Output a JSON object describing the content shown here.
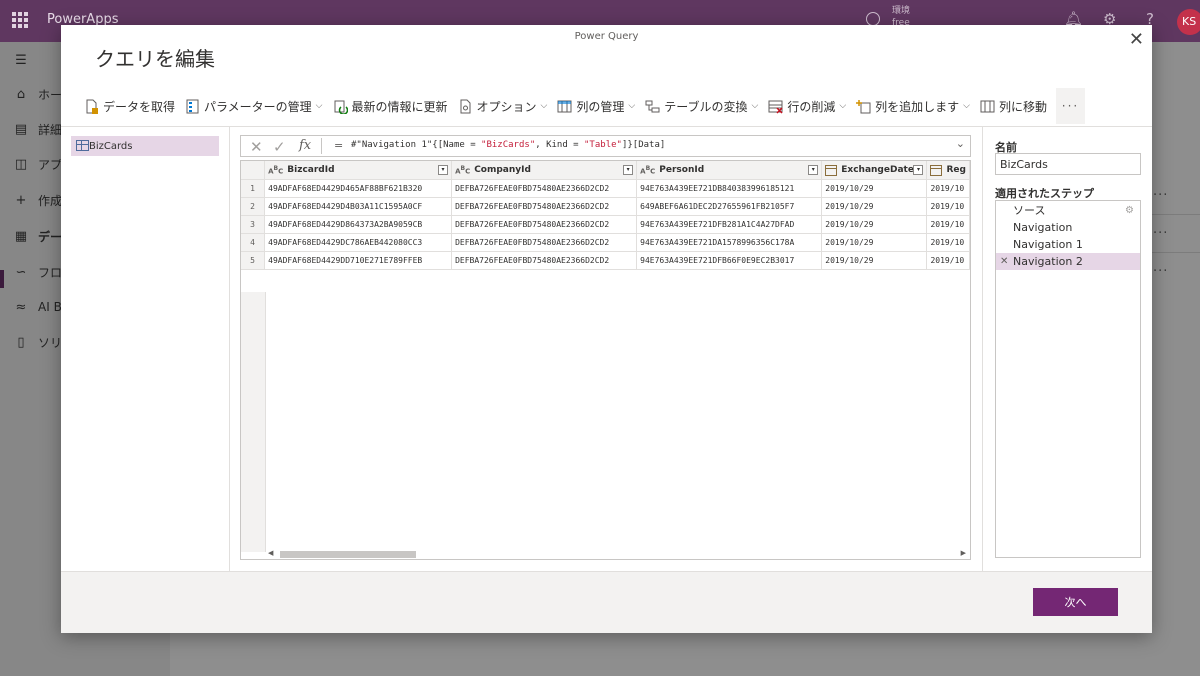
{
  "app": {
    "name": "PowerApps",
    "environment_label": "環境",
    "environment_value": "free",
    "avatar_initials": "KS"
  },
  "nav": {
    "items": [
      {
        "label": "ホー",
        "icon": "home-icon"
      },
      {
        "label": "詳細",
        "icon": "book-icon"
      },
      {
        "label": "アプ",
        "icon": "apps-icon"
      },
      {
        "label": "作成",
        "icon": "plus-icon"
      },
      {
        "label": "デー",
        "icon": "table-icon"
      },
      {
        "label": "フロ",
        "icon": "flow-icon"
      },
      {
        "label": "AI Bu",
        "icon": "ai-builder-icon"
      },
      {
        "label": "ソリ",
        "icon": "solutions-icon"
      }
    ]
  },
  "dialog": {
    "source": "Power Query",
    "title": "クエリを編集",
    "close_glyph": "✕"
  },
  "ribbon": {
    "get_data": "データを取得",
    "manage_params": "パラメーターの管理",
    "refresh": "最新の情報に更新",
    "options": "オプション",
    "manage_columns": "列の管理",
    "transform_table": "テーブルの変換",
    "reduce_rows": "行の削減",
    "add_column": "列を追加します",
    "go_to_column": "列に移動",
    "more": "···"
  },
  "queries": {
    "items": [
      {
        "label": "BizCards"
      }
    ]
  },
  "formula": {
    "eq": "=",
    "prefix": "#\"Navigation 1\"{[Name = ",
    "name_str": "\"BizCards\"",
    "mid": ", Kind = ",
    "kind_str": "\"Table\"",
    "suffix": "]}[Data]"
  },
  "grid": {
    "columns": [
      "BizcardId",
      "CompanyId",
      "PersonId",
      "ExchangeDate",
      "Reg"
    ],
    "rows": [
      {
        "n": "1",
        "cells": [
          "49ADFAF68ED4429D465AF88BF621B320",
          "DEFBA726FEAE0FBD75480AE2366D2CD2",
          "94E763A439EE721DB840383996185121",
          "2019/10/29",
          "2019/10"
        ]
      },
      {
        "n": "2",
        "cells": [
          "49ADFAF68ED4429D4B03A11C1595A0CF",
          "DEFBA726FEAE0FBD75480AE2366D2CD2",
          "649ABEF6A61DEC2D27655961FB2105F7",
          "2019/10/29",
          "2019/10"
        ]
      },
      {
        "n": "3",
        "cells": [
          "49ADFAF68ED4429D864373A2BA9059CB",
          "DEFBA726FEAE0FBD75480AE2366D2CD2",
          "94E763A439EE721DFB281A1C4A27DFAD",
          "2019/10/29",
          "2019/10"
        ]
      },
      {
        "n": "4",
        "cells": [
          "49ADFAF68ED4429DC786AEB442080CC3",
          "DEFBA726FEAE0FBD75480AE2366D2CD2",
          "94E763A439EE721DA1578996356C178A",
          "2019/10/29",
          "2019/10"
        ]
      },
      {
        "n": "5",
        "cells": [
          "49ADFAF68ED4429DD710E271E789FFEB",
          "DEFBA726FEAE0FBD75480AE2366D2CD2",
          "94E763A439EE721DFB66F0E9EC2B3017",
          "2019/10/29",
          "2019/10"
        ]
      }
    ]
  },
  "settings": {
    "name_label": "名前",
    "name_value": "BizCards",
    "steps_label": "適用されたステップ",
    "steps": [
      "ソース",
      "Navigation",
      "Navigation 1",
      "Navigation 2"
    ],
    "selected_step": "Navigation 2"
  },
  "footer": {
    "next_label": "次へ"
  },
  "colors": {
    "brand": "#742774",
    "top_bar": "#5f3760",
    "selection": "#e6d6e6"
  }
}
